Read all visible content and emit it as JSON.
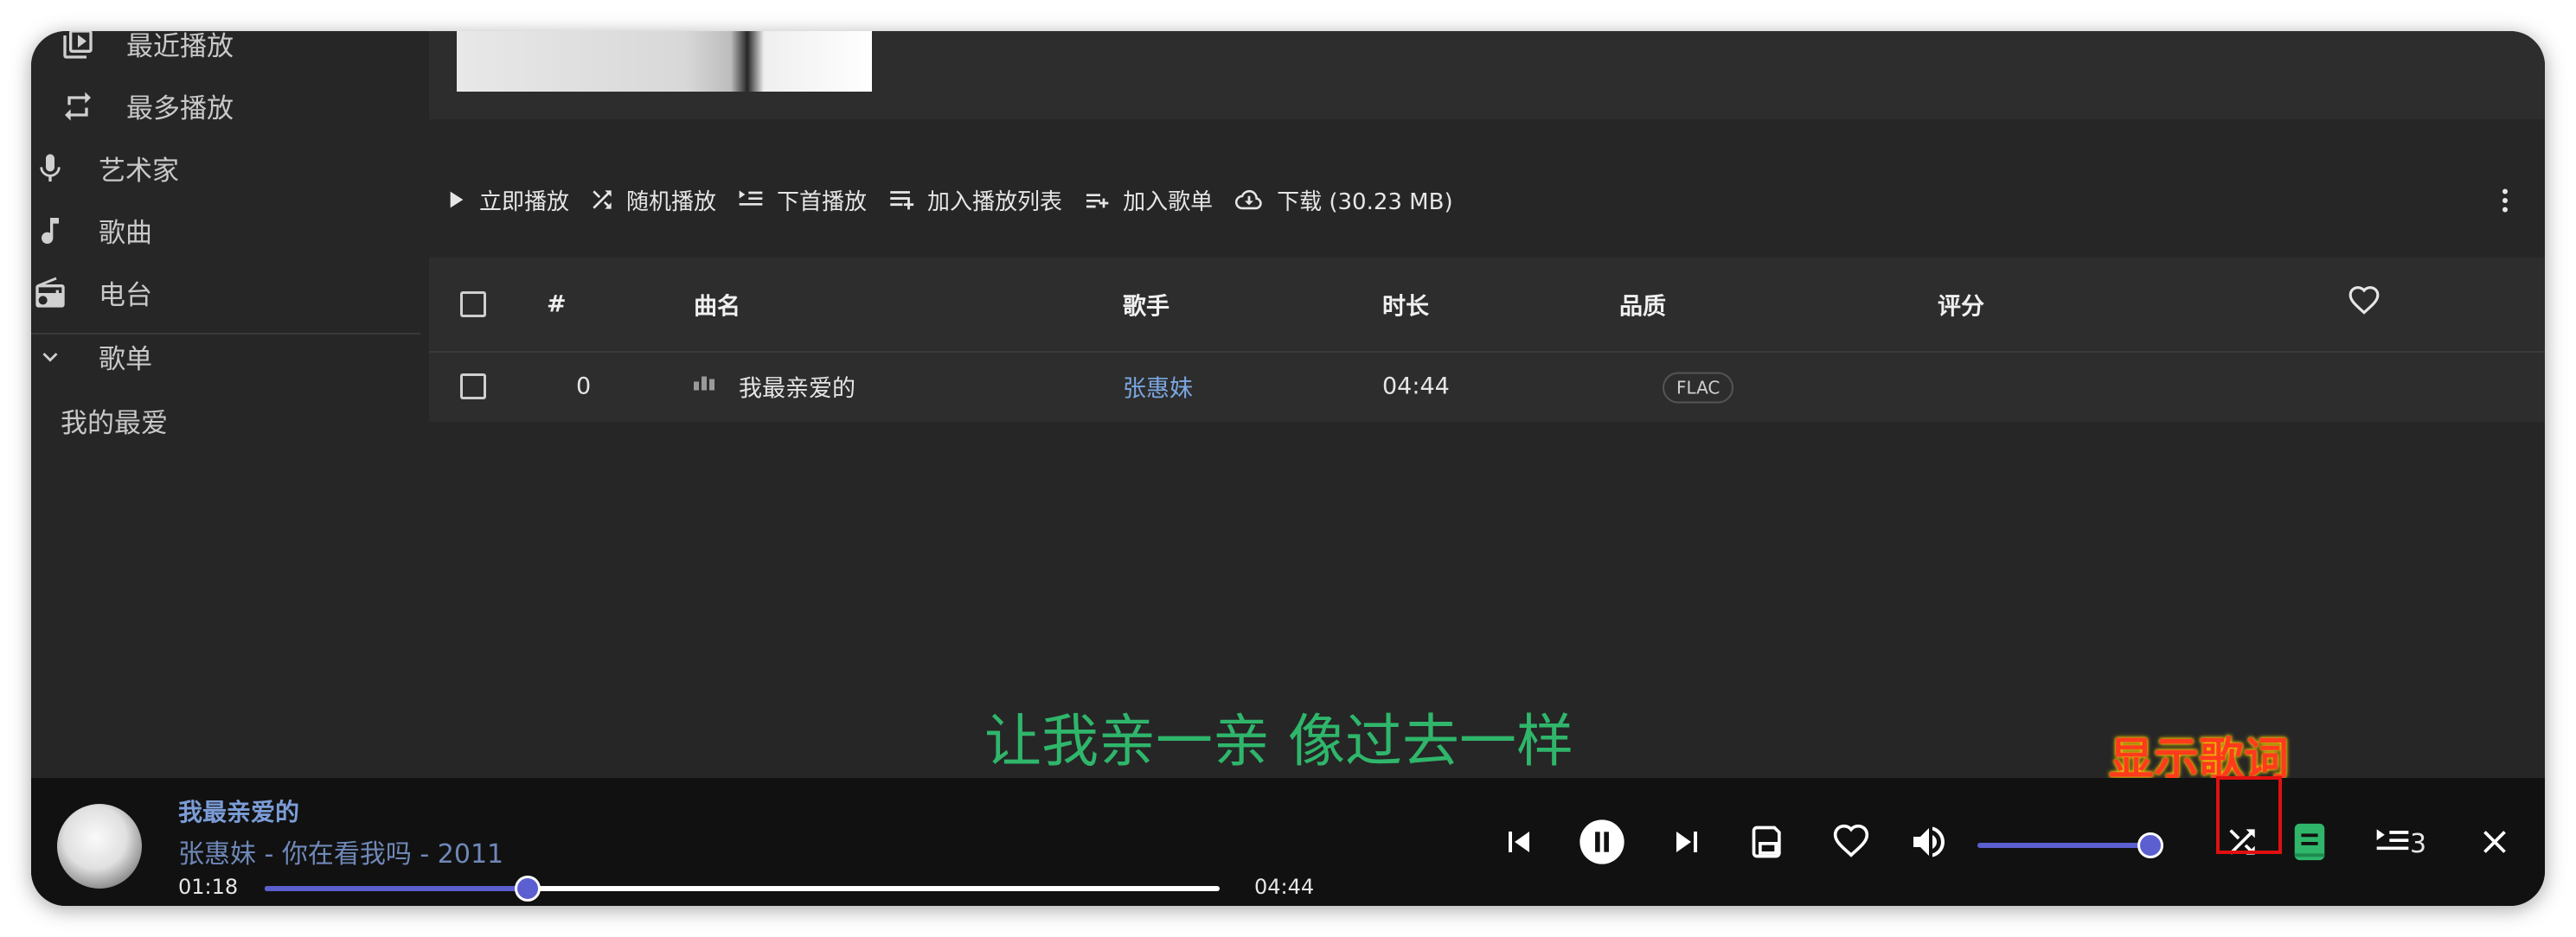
{
  "sidebar": {
    "items": [
      {
        "label": "最近播放",
        "icon": "recent-play-icon"
      },
      {
        "label": "最多播放",
        "icon": "repeat-icon"
      },
      {
        "label": "艺术家",
        "icon": "microphone-icon"
      },
      {
        "label": "歌曲",
        "icon": "music-note-icon"
      },
      {
        "label": "电台",
        "icon": "radio-icon"
      },
      {
        "label": "歌单",
        "icon": "chevron-down-icon"
      },
      {
        "label": "我的最爱"
      }
    ]
  },
  "toolbar": {
    "play_now": "立即播放",
    "shuffle_play": "随机播放",
    "play_next": "下首播放",
    "add_to_queue": "加入播放列表",
    "add_to_playlist": "加入歌单",
    "download": "下载 (30.23 MB)"
  },
  "table": {
    "headers": {
      "index": "#",
      "title": "曲名",
      "artist": "歌手",
      "duration": "时长",
      "quality": "品质",
      "rating": "评分"
    },
    "rows": [
      {
        "index": "0",
        "title": "我最亲爱的",
        "artist": "张惠妹",
        "duration": "04:44",
        "quality": "FLAC"
      }
    ]
  },
  "lyric": "让我亲一亲 像过去一样",
  "annotation": "显示歌词",
  "player": {
    "title": "我最亲爱的",
    "subtitle": "张惠妹 - 你在看我吗 - 2011",
    "elapsed": "01:18",
    "total": "04:44",
    "progress": 0.275,
    "volume": 1.0,
    "queue_count": "3"
  },
  "colors": {
    "accent": "#5c5fcf",
    "lyric": "#2fb66b",
    "link": "#7ba7e0",
    "annotation": "#ff3b1d"
  }
}
